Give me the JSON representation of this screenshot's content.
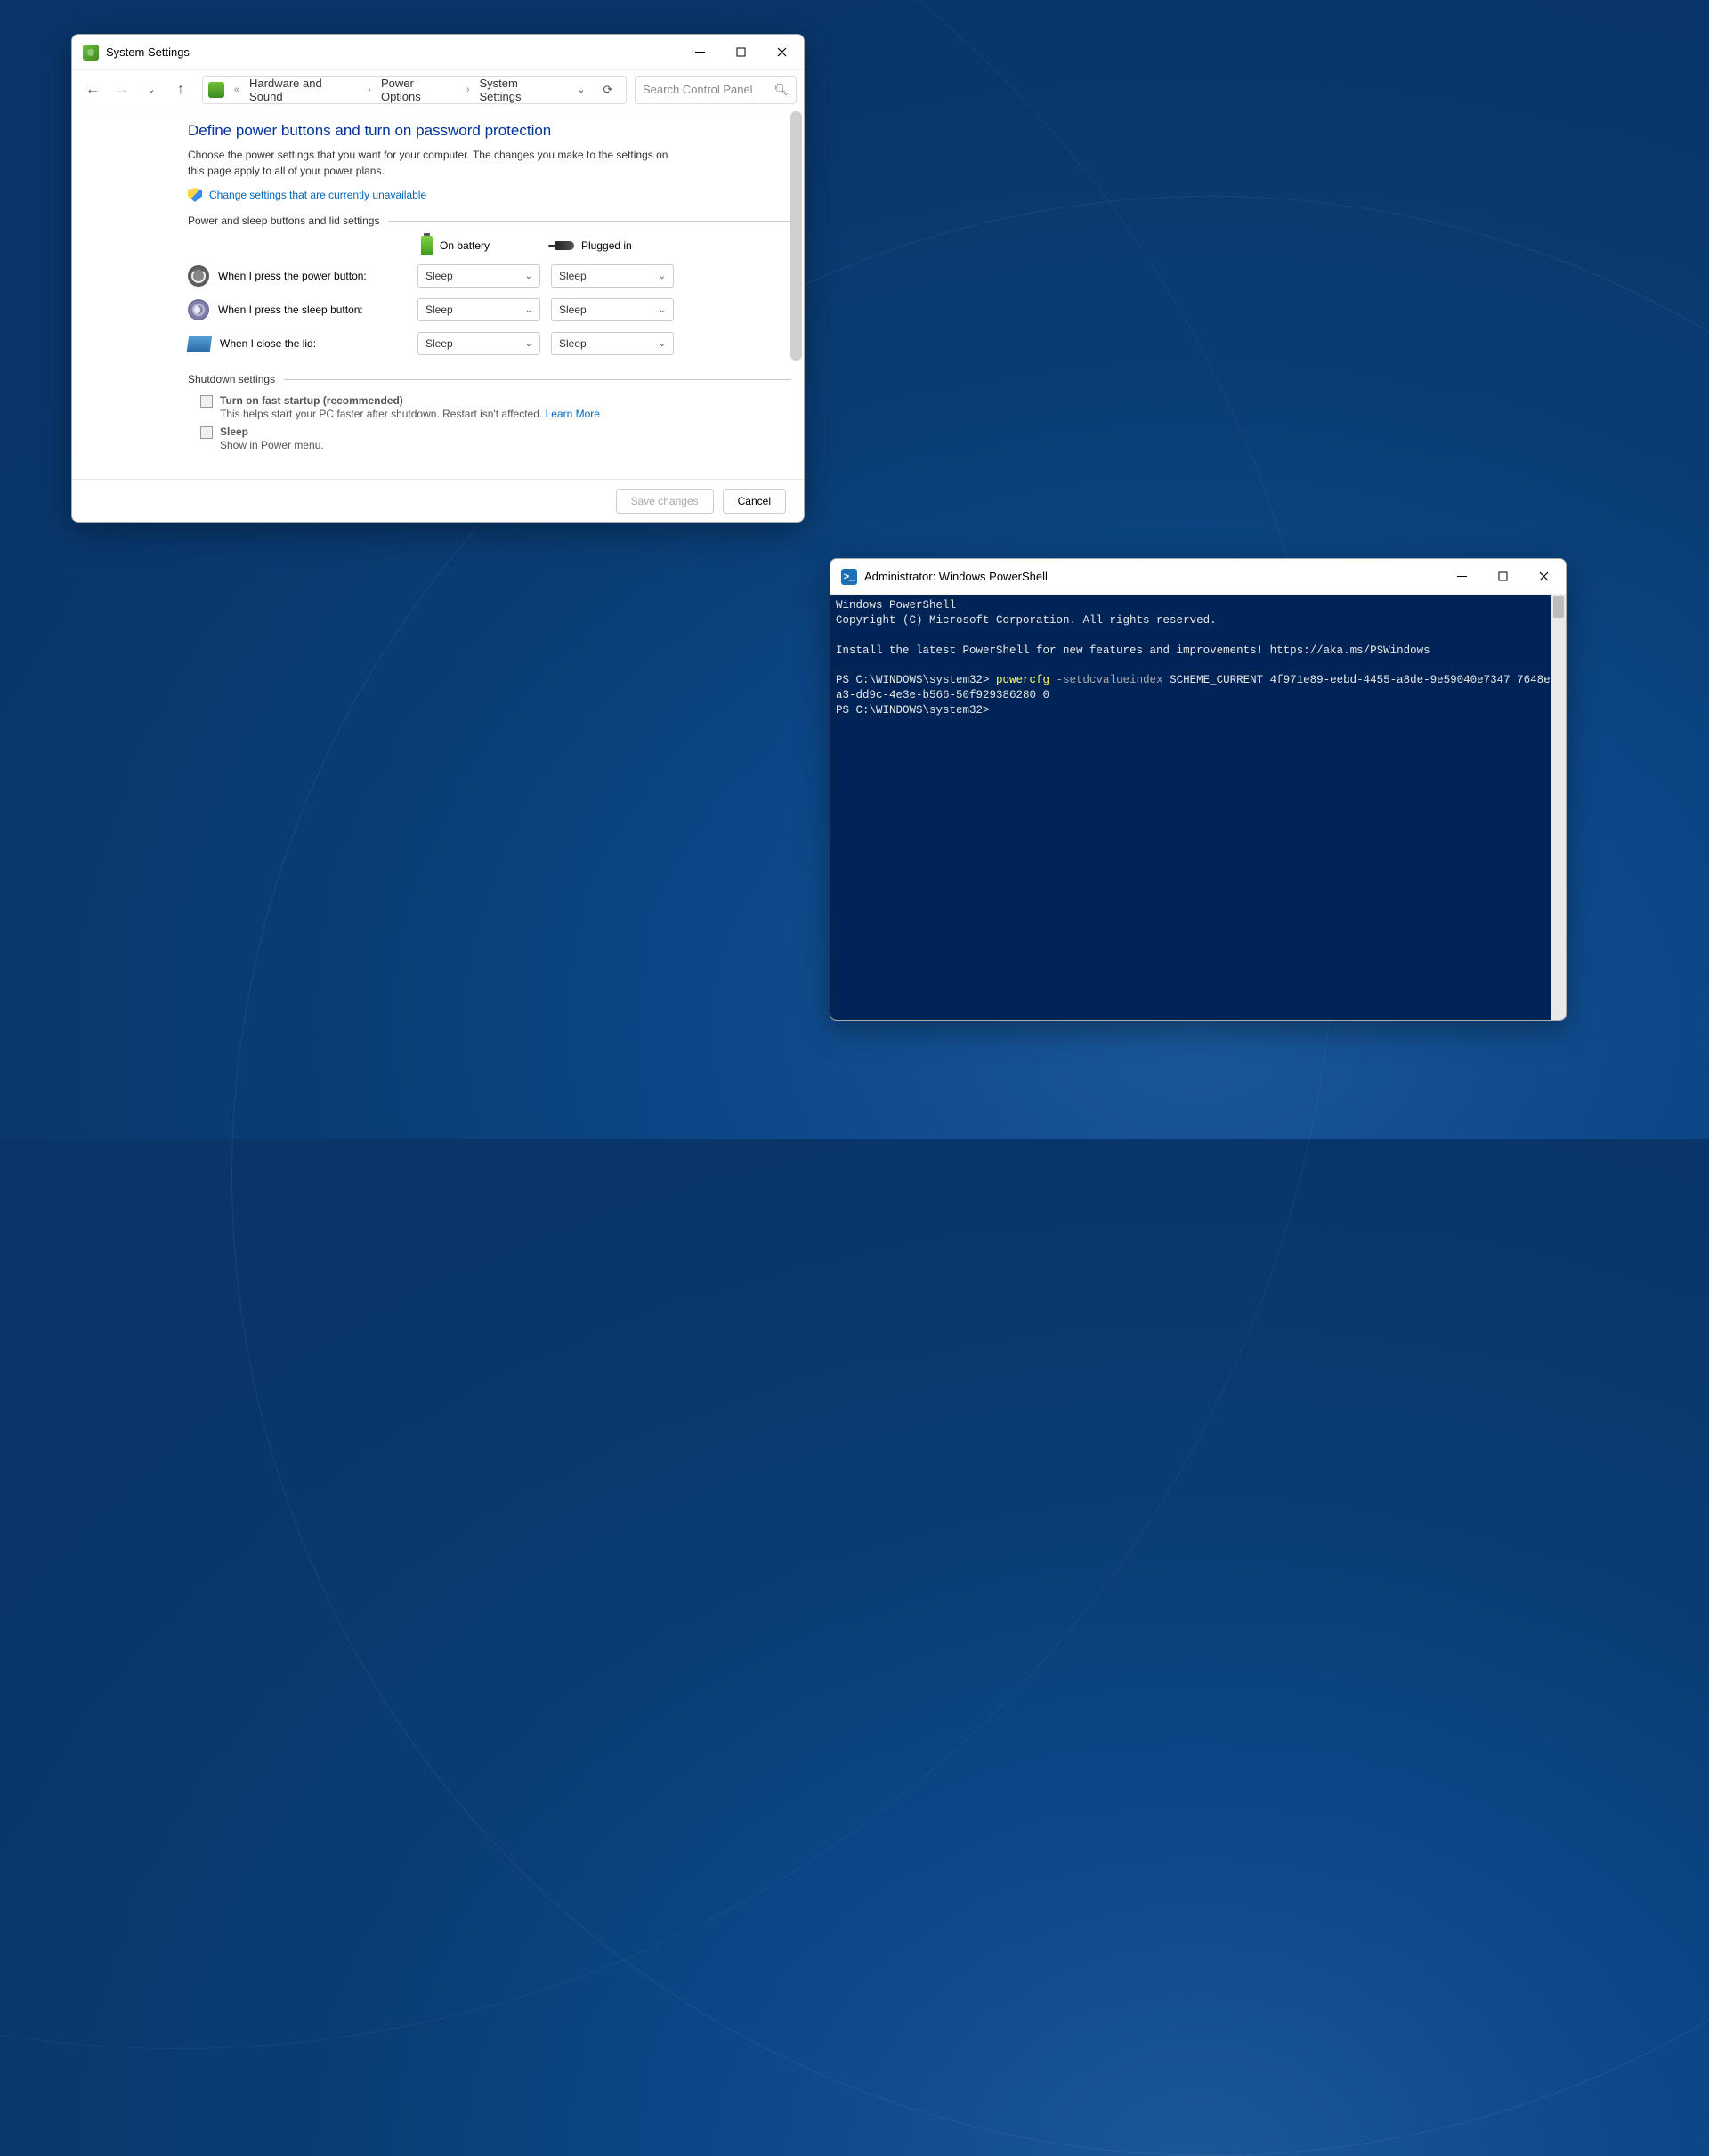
{
  "settings_window": {
    "title": "System Settings",
    "breadcrumb": {
      "sep_initial": "«",
      "items": [
        "Hardware and Sound",
        "Power Options",
        "System Settings"
      ]
    },
    "search_placeholder": "Search Control Panel",
    "heading": "Define power buttons and turn on password protection",
    "description": "Choose the power settings that you want for your computer. The changes you make to the settings on this page apply to all of your power plans.",
    "shield_link": "Change settings that are currently unavailable",
    "section1_label": "Power and sleep buttons and lid settings",
    "col_on_battery": "On battery",
    "col_plugged_in": "Plugged in",
    "rows": [
      {
        "label": "When I press the power button:",
        "battery": "Sleep",
        "plugged": "Sleep"
      },
      {
        "label": "When I press the sleep button:",
        "battery": "Sleep",
        "plugged": "Sleep"
      },
      {
        "label": "When I close the lid:",
        "battery": "Sleep",
        "plugged": "Sleep"
      }
    ],
    "section2_label": "Shutdown settings",
    "fast_startup_label": "Turn on fast startup (recommended)",
    "fast_startup_hint": "This helps start your PC faster after shutdown. Restart isn't affected. ",
    "learn_more": "Learn More",
    "sleep_label": "Sleep",
    "sleep_hint": "Show in Power menu.",
    "save_btn": "Save changes",
    "cancel_btn": "Cancel"
  },
  "ps_window": {
    "title": "Administrator: Windows PowerShell",
    "lines": {
      "l1": "Windows PowerShell",
      "l2": "Copyright (C) Microsoft Corporation. All rights reserved.",
      "l3": "Install the latest PowerShell for new features and improvements! https://aka.ms/PSWindows",
      "prompt1": "PS C:\\WINDOWS\\system32> ",
      "cmd": "powercfg",
      "flag": " -setdcvalueindex",
      "args": " SCHEME_CURRENT 4f971e89-eebd-4455-a8de-9e59040e7347 7648efa3-dd9c-4e3e-b566-50f929386280 0",
      "prompt2": "PS C:\\WINDOWS\\system32>"
    }
  }
}
